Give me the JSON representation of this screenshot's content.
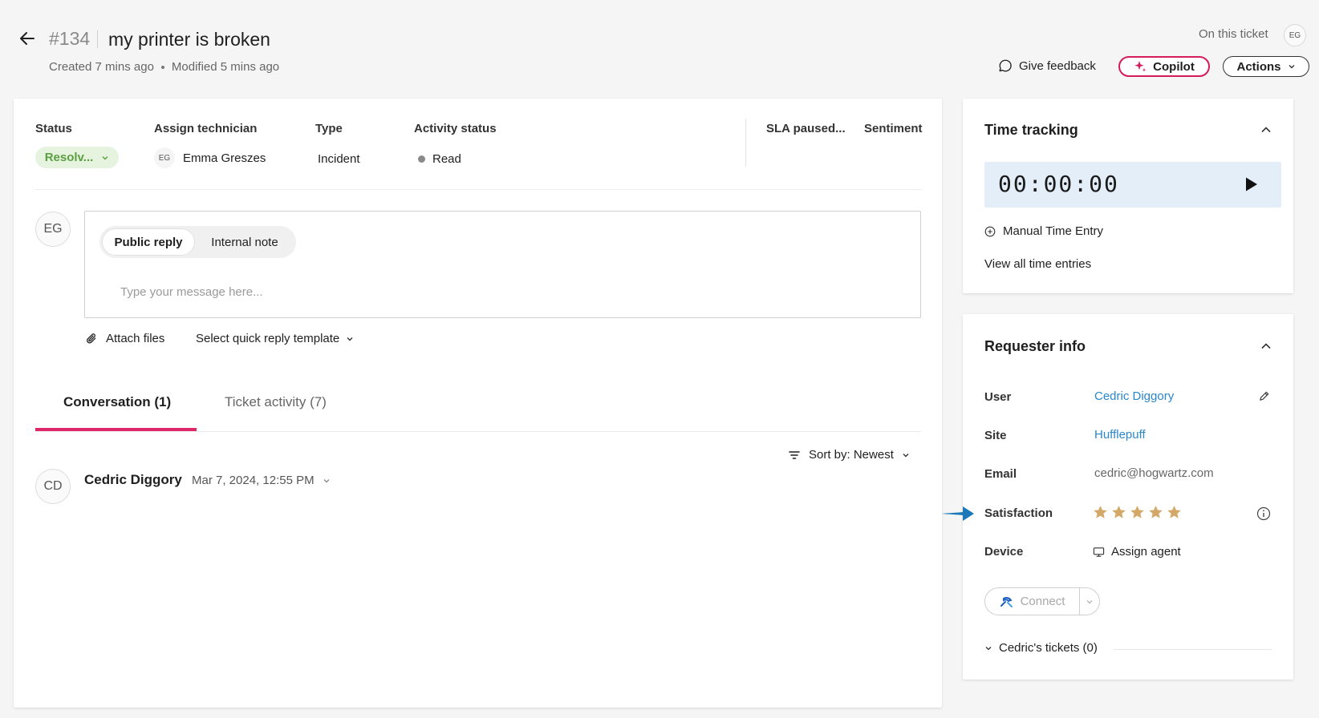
{
  "header": {
    "ticket_id": "#134",
    "title": "my printer is broken",
    "created": "Created 7 mins ago",
    "modified": "Modified 5 mins ago",
    "on_ticket_label": "On this ticket",
    "on_ticket_avatar": "EG",
    "give_feedback": "Give feedback",
    "copilot": "Copilot",
    "actions": "Actions"
  },
  "ticket_fields": {
    "status_label": "Status",
    "status_value": "Resolv...",
    "assign_label": "Assign technician",
    "assign_avatar": "EG",
    "assign_value": "Emma Greszes",
    "type_label": "Type",
    "type_value": "Incident",
    "activity_label": "Activity status",
    "activity_value": "Read",
    "sla_label": "SLA paused...",
    "sentiment_label": "Sentiment"
  },
  "reply": {
    "avatar": "EG",
    "public_reply": "Public reply",
    "internal_note": "Internal note",
    "placeholder": "Type your message here...",
    "attach_files": "Attach files",
    "quick_reply": "Select quick reply template"
  },
  "tabs": [
    {
      "label": "Conversation (1)",
      "active": true
    },
    {
      "label": "Ticket activity (7)",
      "active": false
    }
  ],
  "sort": {
    "label": "Sort by: Newest"
  },
  "conversation": [
    {
      "avatar": "CD",
      "name": "Cedric Diggory",
      "date": "Mar 7, 2024, 12:55 PM"
    }
  ],
  "time_tracking": {
    "title": "Time tracking",
    "timer": "00:00:00",
    "manual_entry": "Manual Time Entry",
    "view_all": "View all time entries"
  },
  "requester": {
    "title": "Requester info",
    "user_label": "User",
    "user_value": "Cedric Diggory",
    "site_label": "Site",
    "site_value": "Hufflepuff",
    "email_label": "Email",
    "email_value": "cedric@hogwartz.com",
    "satisfaction_label": "Satisfaction",
    "satisfaction_stars": 5,
    "device_label": "Device",
    "device_value": "Assign agent",
    "connect": "Connect",
    "tickets": "Cedric's tickets (0)"
  },
  "colors": {
    "accent_pink": "#e0266b",
    "link_blue": "#2a87c9",
    "status_green": "#5aa040",
    "star_gold": "#d4a868",
    "arrow_blue": "#1a78b8"
  }
}
